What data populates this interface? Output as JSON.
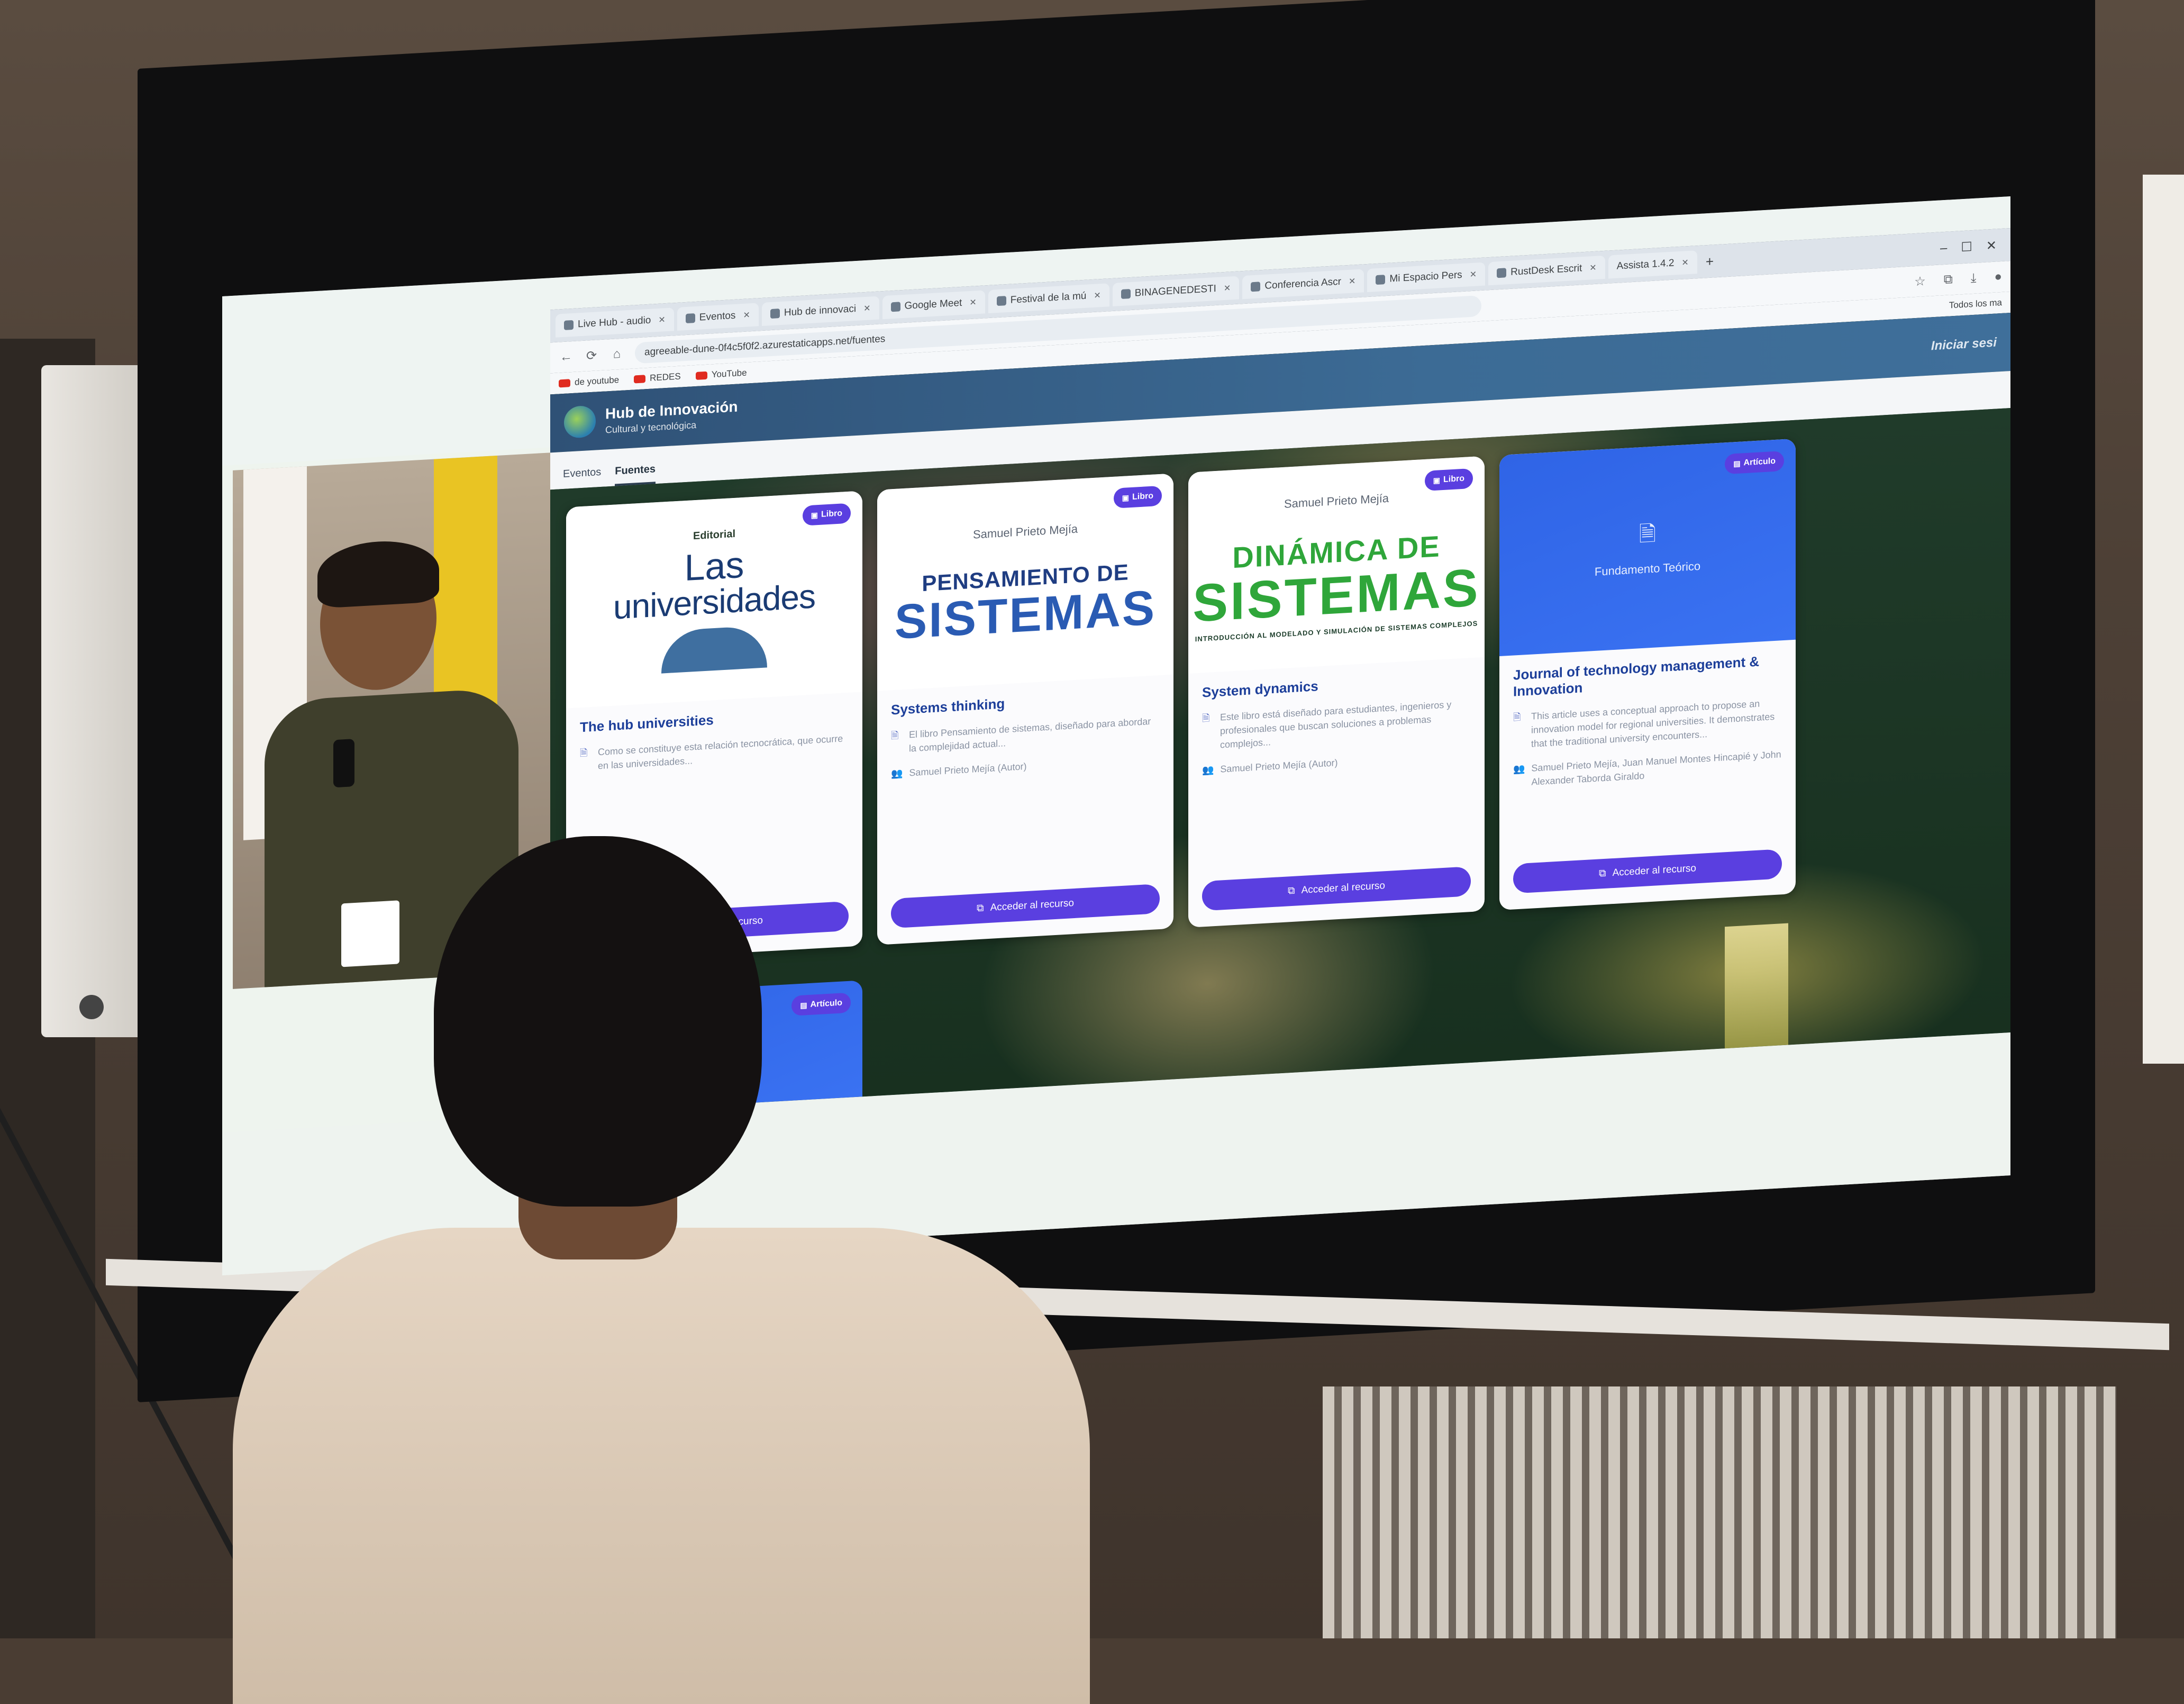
{
  "browser": {
    "tabs": [
      {
        "label": "Live Hub - audio"
      },
      {
        "label": "Eventos"
      },
      {
        "label": "Hub de innovaci"
      },
      {
        "label": "Google Meet"
      },
      {
        "label": "Festival de la mú"
      },
      {
        "label": "BINAGENEDESTI"
      },
      {
        "label": "Conferencia Ascr"
      },
      {
        "label": "Mi Espacio Pers"
      },
      {
        "label": "RustDesk Escrit"
      },
      {
        "label": "Assista 1.4.2"
      }
    ],
    "new_tab": "+",
    "window_controls": [
      "–",
      "☐",
      "✕"
    ],
    "back": "←",
    "reload": "⟳",
    "home": "⌂",
    "url": "agreeable-dune-0f4c5f0f2.azurestaticapps.net/fuentes",
    "toolbar_icons": [
      "☆",
      "⧉",
      "⤓",
      "●"
    ],
    "bookmarks": [
      {
        "label": "de youtube"
      },
      {
        "label": "REDES"
      },
      {
        "label": "YouTube"
      }
    ],
    "all_bookmarks": "Todos los ma"
  },
  "site": {
    "title": "Hub de Innovación",
    "subtitle": "Cultural y tecnológica",
    "login": "Iniciar sesi",
    "nav": [
      {
        "label": "Eventos",
        "active": false
      },
      {
        "label": "Fuentes",
        "active": true
      }
    ]
  },
  "cards": [
    {
      "badge": "Libro",
      "badge_icon": "▣",
      "cover": {
        "editorial": "Editorial",
        "line1": "Las",
        "line2": "universidades"
      },
      "title": "The hub universities",
      "description": "Como se constituye esta relación tecnocrática, que ocurre en las universidades...",
      "authors": "",
      "button": "Acceder al recurso"
    },
    {
      "badge": "Libro",
      "badge_icon": "▣",
      "cover": {
        "author": "Samuel Prieto Mejía",
        "line1": "PENSAMIENTO DE",
        "line2": "SISTEMAS"
      },
      "title": "Systems thinking",
      "description": "El libro Pensamiento de sistemas, diseñado para abordar la complejidad actual...",
      "authors": "Samuel Prieto Mejía (Autor)",
      "button": "Acceder al recurso"
    },
    {
      "badge": "Libro",
      "badge_icon": "▣",
      "cover": {
        "author": "Samuel Prieto Mejía",
        "line1": "DINÁMICA DE",
        "line2": "SISTEMAS",
        "subline": "INTRODUCCIÓN AL MODELADO Y SIMULACIÓN DE SISTEMAS COMPLEJOS"
      },
      "title": "System dynamics",
      "description": "Este libro está diseñado para estudiantes, ingenieros y profesionales que buscan soluciones a problemas complejos...",
      "authors": "Samuel Prieto Mejía (Autor)",
      "button": "Acceder al recurso"
    },
    {
      "badge": "Artículo",
      "badge_icon": "▤",
      "cover": {
        "label": "Fundamento Teórico"
      },
      "title": "Journal of technology management & Innovation",
      "description": "This article uses a conceptual approach to propose an innovation model for regional universities. It demonstrates that the traditional university encounters...",
      "authors": "Samuel Prieto Mejía, Juan Manuel Montes Hincapié y John Alexander Taborda Giraldo",
      "button": "Acceder al recurso"
    }
  ],
  "second_row": [
    {
      "badge": "Artículo",
      "badge_icon": "▤"
    }
  ],
  "icons": {
    "doc": "🗎",
    "author": "👥",
    "open": "⧉"
  }
}
